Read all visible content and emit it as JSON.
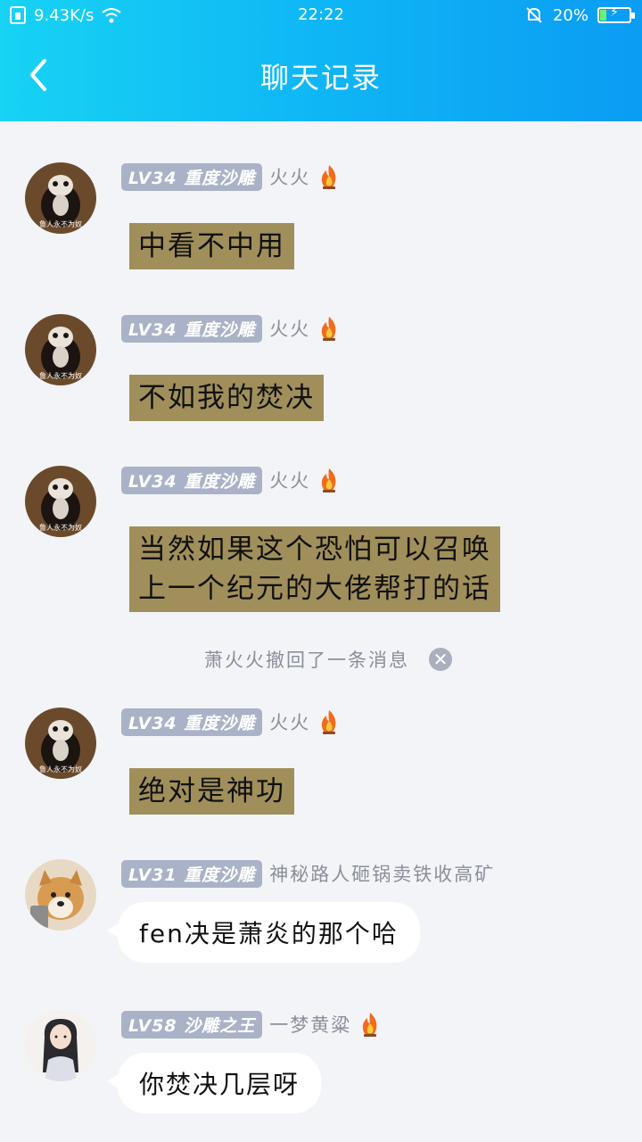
{
  "status_bar": {
    "speed": "9.43K/s",
    "time": "22:22",
    "battery": "20%"
  },
  "header": {
    "title": "聊天记录"
  },
  "messages": [
    {
      "badge": "LV34 重度沙雕",
      "nick": "火火",
      "text": "中看不中用"
    },
    {
      "badge": "LV34 重度沙雕",
      "nick": "火火",
      "text": "不如我的焚决"
    },
    {
      "badge": "LV34 重度沙雕",
      "nick": "火火",
      "line1": "当然如果这个恐怕可以召唤",
      "line2": "上一个纪元的大佬帮打的话"
    },
    {
      "badge": "LV34 重度沙雕",
      "nick": "火火",
      "text": "绝对是神功"
    },
    {
      "badge": "LV31 重度沙雕",
      "nick": "神秘路人砸锅卖铁收高矿",
      "text": "fen决是萧炎的那个哈"
    },
    {
      "badge": "LV58 沙雕之王",
      "nick": "一梦黄粱",
      "text": "你焚决几层呀"
    }
  ],
  "recall": {
    "text": "萧火火撤回了一条消息"
  },
  "avatar_caption": "鲁人永不为奴"
}
